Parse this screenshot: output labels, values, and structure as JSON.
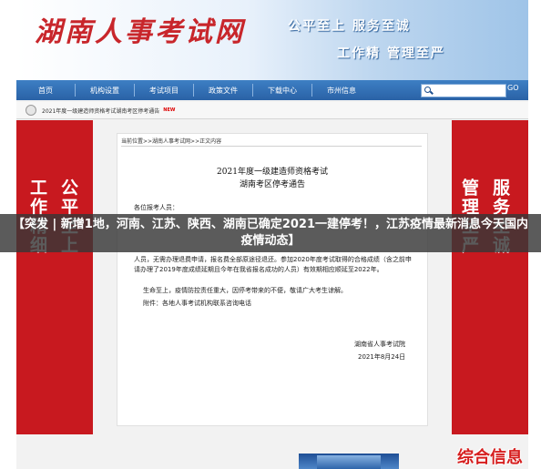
{
  "header": {
    "site_logo": "湖南人事考试网",
    "slogan_1": "公平至上 服务至诚",
    "slogan_2": "工作精 管理至严"
  },
  "nav": {
    "items": [
      "首页",
      "机构设置",
      "考试项目",
      "政策文件",
      "下载中心",
      "市州信息"
    ]
  },
  "search": {
    "go_label": "GO"
  },
  "ticker": {
    "text": "2021年度一级建造师资格考试湖南考区停考通告",
    "badge": "NEW"
  },
  "side_left": {
    "col1": "公平至上",
    "col2": "工作精细"
  },
  "side_right": {
    "col1": "服务至诚",
    "col2": "管理至严"
  },
  "content": {
    "breadcrumb": "当前位置>>湖南人事考试网>>正文内容",
    "title_1": "2021年度一级建造师资格考试",
    "title_2": "湖南考区停考通告",
    "salutation": "各位报考人员：",
    "para_1": "人员，无需办理退费申请，报名费全部原途径退还。参加2020年度考试取得的合格成绩（含之前申请办理了2019年度成绩延期且今年在我省报名成功的人员）有效期相应顺延至2022年。",
    "para_2": "生命至上，疫情防控责任重大，因停考带来的不便，敬请广大考生谅解。",
    "para_3": "附件：各地人事考试机构联系咨询电话",
    "sign_org": "湖南省人事考试院",
    "sign_date": "2021年8月24日"
  },
  "banner": {
    "text": "【突发 | 新增1地，河南、江苏、陕西、湖南已确定2021一建停考！，江苏疫情最新消息今天国内疫情动态】"
  },
  "watermark": {
    "text": "综合信息"
  },
  "colors": {
    "nav_blue": "#2a62a6",
    "side_red": "#c8191f",
    "logo_red": "#c8262b"
  }
}
